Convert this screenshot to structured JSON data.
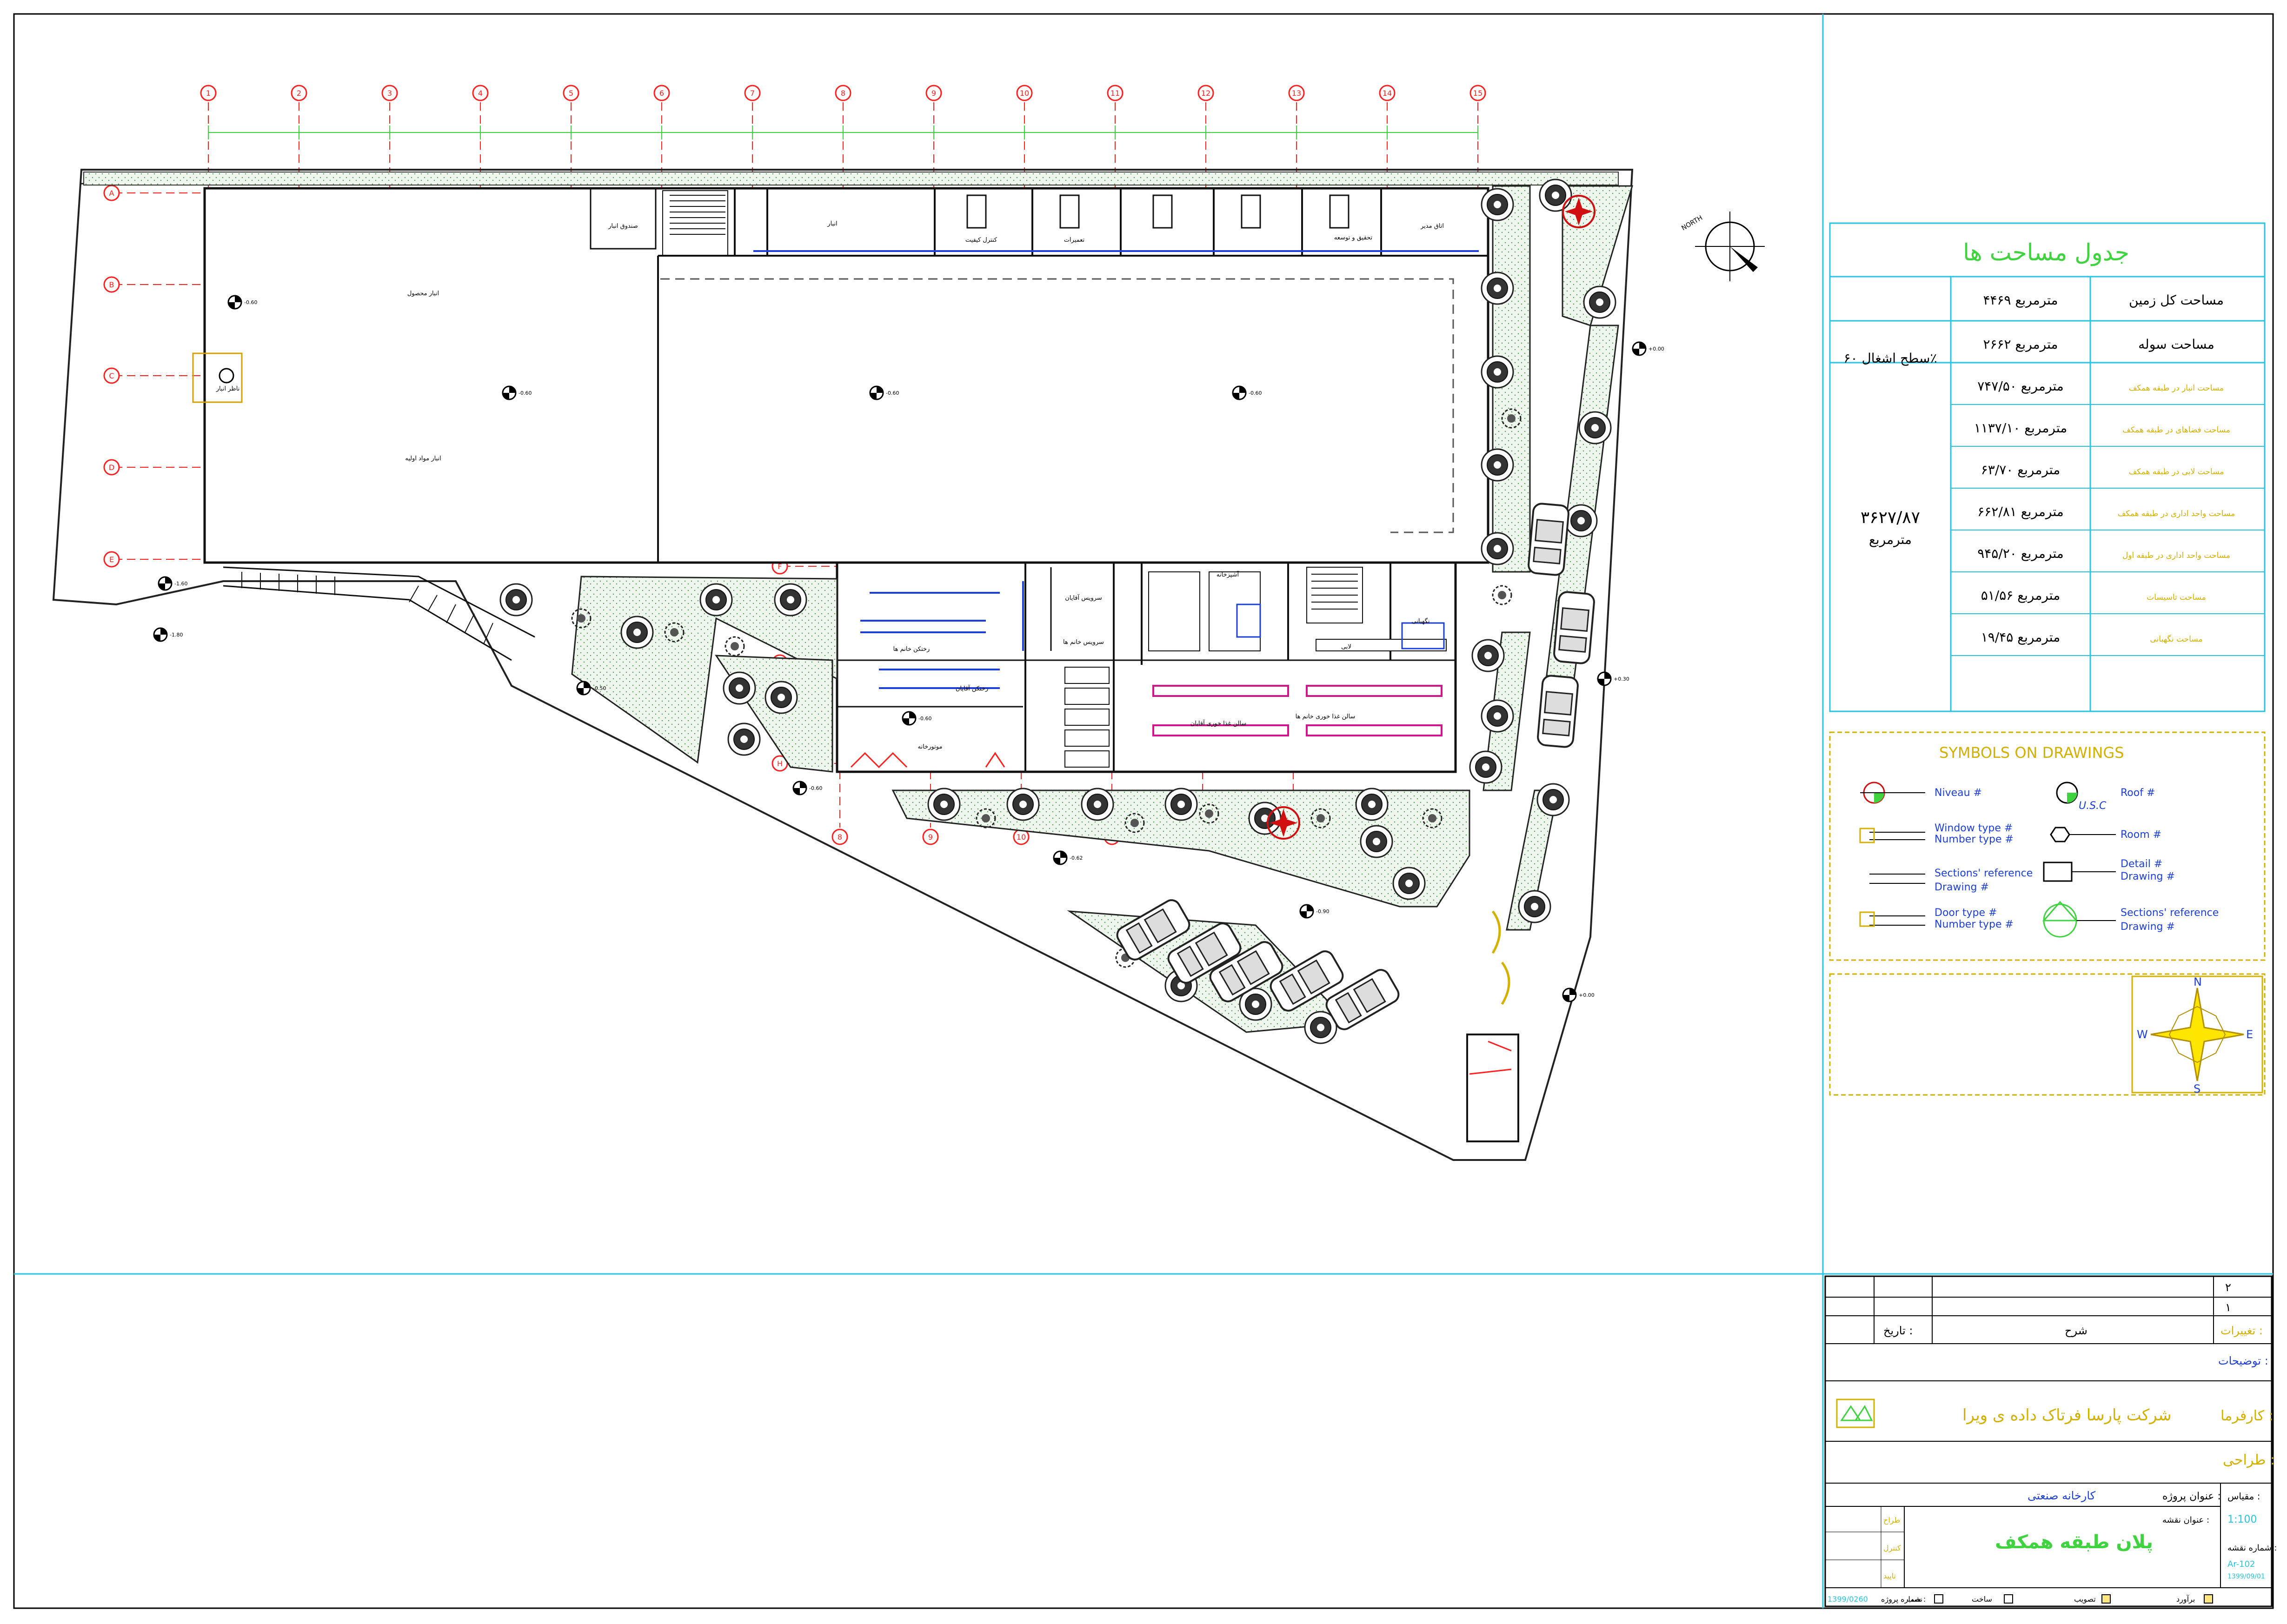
{
  "grid": {
    "columns": [
      "1",
      "2",
      "3",
      "4",
      "5",
      "6",
      "7",
      "8",
      "9",
      "10",
      "11",
      "12",
      "13",
      "14",
      "15"
    ],
    "rows": [
      "A",
      "B",
      "C",
      "D",
      "E",
      "F",
      "G",
      "H"
    ],
    "bottom_columns": [
      "8",
      "9",
      "10",
      "11",
      "12",
      "13"
    ]
  },
  "rooms": {
    "anbar_mahsool": "انبار محصول",
    "anbar_mavad": "انبار مواد اولیه",
    "sandogh": "صندوق انبار",
    "anbar_small": "انبار",
    "control": "کنترل کیفیت",
    "tasisat": "تعمیرات",
    "tahghigh": "تحقیق و توسعه",
    "aghaye": "اتاق مدیر",
    "rakhtkan_kh": "رختکن خانم ها",
    "rakhtkan_a": "رختکن آقایان",
    "serv_a": "سرویس آقایان",
    "serv_kh": "سرویس خانم ها",
    "motor": "موتورخانه",
    "salon_ghaza_kh": "سالن غذا خوری خانم ها",
    "salon_ghaza_a": "سالن غذا خوری آقایان",
    "kitchen": "آشپزخانه",
    "labi": "لابی",
    "negahbani": "نگهبانی",
    "nazer": "ناظر انبار"
  },
  "levels": [
    "-0.60",
    "-0.60",
    "-0.60",
    "-0.60",
    "+0.00",
    "-1.60",
    "-1.80",
    "-0.50",
    "+0.30",
    "-0.60",
    "-0.90",
    "+0.00",
    "-0.62",
    "-0.60"
  ],
  "area_table": {
    "title": "جدول مساحت ها",
    "rows": [
      {
        "label": "مساحت کل زمین",
        "value": "۴۴۶۹ مترمربع"
      },
      {
        "label": "مساحت سوله",
        "value": "۲۶۶۲ مترمربع"
      },
      {
        "label": "مساحت انبار در طبقه همکف",
        "value": "۷۴۷/۵۰ مترمربع"
      },
      {
        "label": "مساحت فضاهای در طبقه همکف",
        "value": "۱۱۳۷/۱۰ مترمربع"
      },
      {
        "label": "مساحت لابی در طبقه همکف",
        "value": "۶۳/۷۰ مترمربع"
      },
      {
        "label": "مساحت واحد اداری در طبقه همکف",
        "value": "۶۶۲/۸۱ مترمربع"
      },
      {
        "label": "مساحت واحد اداری در طبقه اول",
        "value": "۹۴۵/۲۰ مترمربع"
      },
      {
        "label": "مساحت تاسیسات",
        "value": "۵۱/۵۶ مترمربع"
      },
      {
        "label": "مساحت نگهبانی",
        "value": "۱۹/۴۵ مترمربع"
      }
    ],
    "occupancy": "سطح اشغال ۶۰٪",
    "total": "۳۶۲۷/۸۷",
    "total_unit": "مترمربع"
  },
  "legend": {
    "title": "SYMBOLS ON DRAWINGS",
    "niveau": "Niveau #",
    "roof": "Roof #",
    "window_type": "Window type #",
    "number_type1": "Number type #",
    "room": "Room #",
    "sections_ref1": "Sections' reference",
    "drawing1": "Drawing #",
    "detail": "Detail #",
    "drawing2": "Drawing #",
    "door_type": "Door type #",
    "number_type2": "Number type #",
    "sections_ref2": "Sections' reference",
    "drawing3": "Drawing #",
    "usc": "U.S.C"
  },
  "compass": {
    "n": "N",
    "s": "S",
    "e": "E",
    "w": "W"
  },
  "north_label": "NORTH",
  "title_block": {
    "rev_2": "۲",
    "rev_1": "۱",
    "taghirat": "تغییرات :",
    "sharh": "شرح",
    "tarikh": "تاریخ :",
    "toozih": "توضیحات :",
    "karfarma_label": "کارفرما :",
    "karfarma": "شرکت پارسا فرتاک داده ی ویرا",
    "tarrahi": "طراحی :",
    "meghyas_label": "مقیاس :",
    "meghyas": "1:100",
    "onvan_proje_label": "عنوان پروژه :",
    "onvan_proje": "کارخانه صنعتی",
    "onvan_naghshe_label": "عنوان نقشه :",
    "onvan_naghshe": "پلان طبقه همکف",
    "shomare_naghshe_label": "شماره نقشه :",
    "shomare_naghshe": "Ar-102",
    "date": "1399/09/01",
    "tarah": "طراح",
    "kontrol": "کنترل",
    "taeed": "تایید",
    "shomare_proje_label": "شماره پروژه :",
    "shomare_proje": "1399/0260",
    "checks": [
      "برآورد",
      "تصویب",
      "ساخت",
      "نصب"
    ]
  }
}
